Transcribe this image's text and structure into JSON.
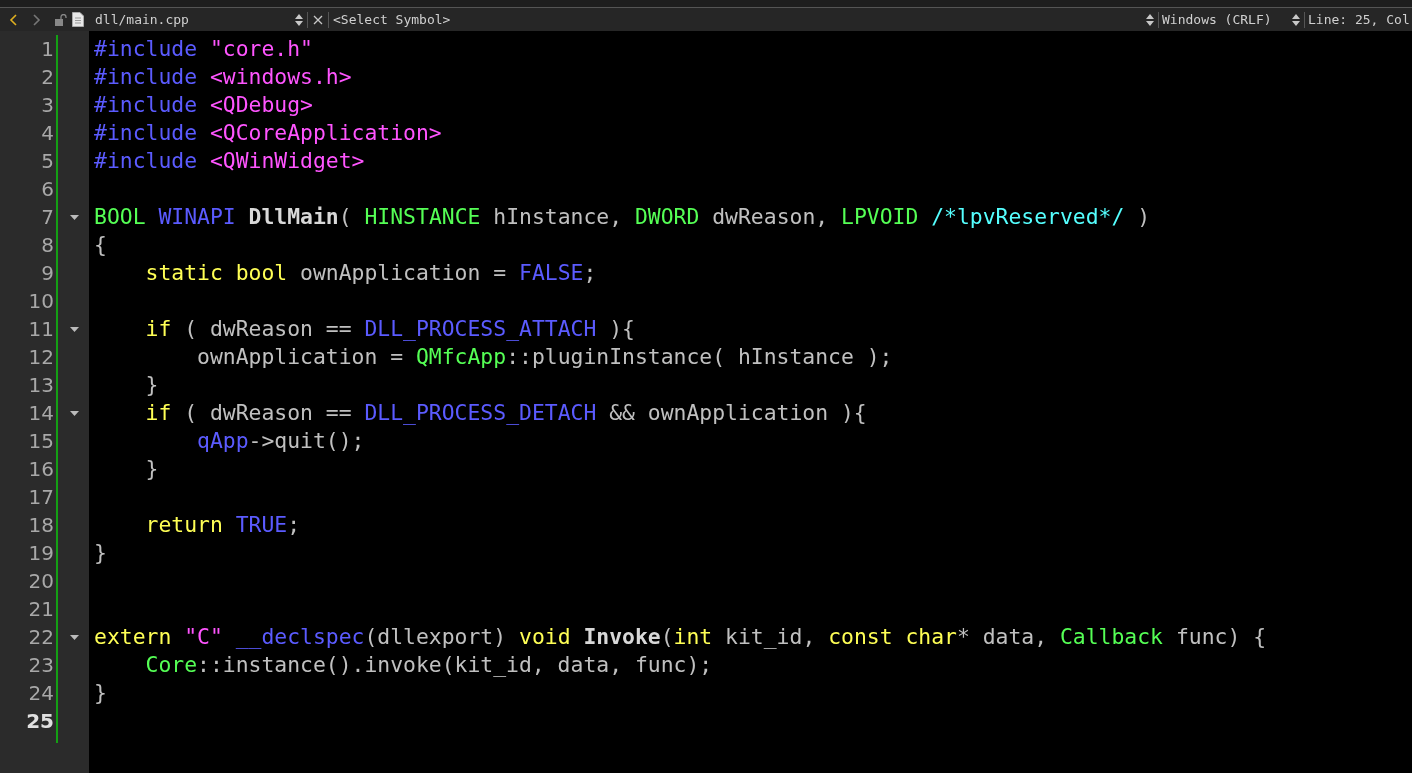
{
  "toolbar": {
    "back": {
      "enabled": true
    },
    "forward": {
      "enabled": false
    },
    "file_name": "dll/main.cpp",
    "symbol": "<Select Symbol>",
    "line_ending": "Windows (CRLF)",
    "position": "Line: 25, Col"
  },
  "editor": {
    "lines": [
      {
        "number": "1",
        "fold": false,
        "current": false,
        "tokens": [
          {
            "kind": "preproc",
            "text": "#include "
          },
          {
            "kind": "string",
            "text": "\"core.h\""
          }
        ]
      },
      {
        "number": "2",
        "fold": false,
        "current": false,
        "tokens": [
          {
            "kind": "preproc",
            "text": "#include "
          },
          {
            "kind": "string",
            "text": "<windows.h>"
          }
        ]
      },
      {
        "number": "3",
        "fold": false,
        "current": false,
        "tokens": [
          {
            "kind": "preproc",
            "text": "#include "
          },
          {
            "kind": "string",
            "text": "<QDebug>"
          }
        ]
      },
      {
        "number": "4",
        "fold": false,
        "current": false,
        "tokens": [
          {
            "kind": "preproc",
            "text": "#include "
          },
          {
            "kind": "string",
            "text": "<QCoreApplication>"
          }
        ]
      },
      {
        "number": "5",
        "fold": false,
        "current": false,
        "tokens": [
          {
            "kind": "preproc",
            "text": "#include "
          },
          {
            "kind": "string",
            "text": "<QWinWidget>"
          }
        ]
      },
      {
        "number": "6",
        "fold": false,
        "current": false
      },
      {
        "number": "7",
        "fold": true,
        "current": false,
        "tokens": [
          {
            "kind": "type",
            "text": "BOOL "
          },
          {
            "kind": "macro",
            "text": "WINAPI "
          },
          {
            "kind": "function",
            "text": "DllMain"
          },
          {
            "kind": "plain",
            "text": "( "
          },
          {
            "kind": "type",
            "text": "HINSTANCE "
          },
          {
            "kind": "plain",
            "text": "hInstance, "
          },
          {
            "kind": "type",
            "text": "DWORD "
          },
          {
            "kind": "plain",
            "text": "dwReason, "
          },
          {
            "kind": "type",
            "text": "LPVOID "
          },
          {
            "kind": "comment",
            "text": "/*lpvReserved*/"
          },
          {
            "kind": "plain",
            "text": " )"
          }
        ]
      },
      {
        "number": "8",
        "fold": false,
        "current": false,
        "tokens": [
          {
            "kind": "plain",
            "text": "{"
          }
        ]
      },
      {
        "number": "9",
        "fold": false,
        "current": false,
        "tokens": [
          {
            "kind": "keyword",
            "text": "    static bool "
          },
          {
            "kind": "plain",
            "text": "ownApplication = "
          },
          {
            "kind": "macro",
            "text": "FALSE"
          },
          {
            "kind": "plain",
            "text": ";"
          }
        ]
      },
      {
        "number": "10",
        "fold": false,
        "current": false
      },
      {
        "number": "11",
        "fold": true,
        "current": false,
        "tokens": [
          {
            "kind": "keyword",
            "text": "    if"
          },
          {
            "kind": "plain",
            "text": " ( dwReason == "
          },
          {
            "kind": "macro",
            "text": "DLL_PROCESS_ATTACH"
          },
          {
            "kind": "plain",
            "text": " ){"
          }
        ]
      },
      {
        "number": "12",
        "fold": false,
        "current": false,
        "tokens": [
          {
            "kind": "plain",
            "text": "        ownApplication = "
          },
          {
            "kind": "type",
            "text": "QMfcApp"
          },
          {
            "kind": "plain",
            "text": "::pluginInstance( hInstance );"
          }
        ]
      },
      {
        "number": "13",
        "fold": false,
        "current": false,
        "tokens": [
          {
            "kind": "plain",
            "text": "    }"
          }
        ]
      },
      {
        "number": "14",
        "fold": true,
        "current": false,
        "tokens": [
          {
            "kind": "keyword",
            "text": "    if"
          },
          {
            "kind": "plain",
            "text": " ( dwReason == "
          },
          {
            "kind": "macro",
            "text": "DLL_PROCESS_DETACH"
          },
          {
            "kind": "plain",
            "text": " && ownApplication ){"
          }
        ]
      },
      {
        "number": "15",
        "fold": false,
        "current": false,
        "tokens": [
          {
            "kind": "macro",
            "text": "        qApp"
          },
          {
            "kind": "plain",
            "text": "->quit();"
          }
        ]
      },
      {
        "number": "16",
        "fold": false,
        "current": false,
        "tokens": [
          {
            "kind": "plain",
            "text": "    }"
          }
        ]
      },
      {
        "number": "17",
        "fold": false,
        "current": false
      },
      {
        "number": "18",
        "fold": false,
        "current": false,
        "tokens": [
          {
            "kind": "keyword",
            "text": "    return "
          },
          {
            "kind": "macro",
            "text": "TRUE"
          },
          {
            "kind": "plain",
            "text": ";"
          }
        ]
      },
      {
        "number": "19",
        "fold": false,
        "current": false,
        "tokens": [
          {
            "kind": "plain",
            "text": "}"
          }
        ]
      },
      {
        "number": "20",
        "fold": false,
        "current": false
      },
      {
        "number": "21",
        "fold": false,
        "current": false
      },
      {
        "number": "22",
        "fold": true,
        "current": false,
        "tokens": [
          {
            "kind": "keyword",
            "text": "extern "
          },
          {
            "kind": "string",
            "text": "\"C\" "
          },
          {
            "kind": "macro",
            "text": "__declspec"
          },
          {
            "kind": "plain",
            "text": "(dllexport) "
          },
          {
            "kind": "keyword",
            "text": "void "
          },
          {
            "kind": "function",
            "text": "Invoke"
          },
          {
            "kind": "plain",
            "text": "("
          },
          {
            "kind": "keyword",
            "text": "int "
          },
          {
            "kind": "plain",
            "text": "kit_id, "
          },
          {
            "kind": "keyword",
            "text": "const char"
          },
          {
            "kind": "plain",
            "text": "* data, "
          },
          {
            "kind": "type",
            "text": "Callback "
          },
          {
            "kind": "plain",
            "text": "func) {"
          }
        ]
      },
      {
        "number": "23",
        "fold": false,
        "current": false,
        "tokens": [
          {
            "kind": "type",
            "text": "    Core"
          },
          {
            "kind": "plain",
            "text": "::instance().invoke(kit_id, data, func);"
          }
        ]
      },
      {
        "number": "24",
        "fold": false,
        "current": false,
        "tokens": [
          {
            "kind": "plain",
            "text": "}"
          }
        ]
      },
      {
        "number": "25",
        "fold": false,
        "current": true
      }
    ]
  }
}
